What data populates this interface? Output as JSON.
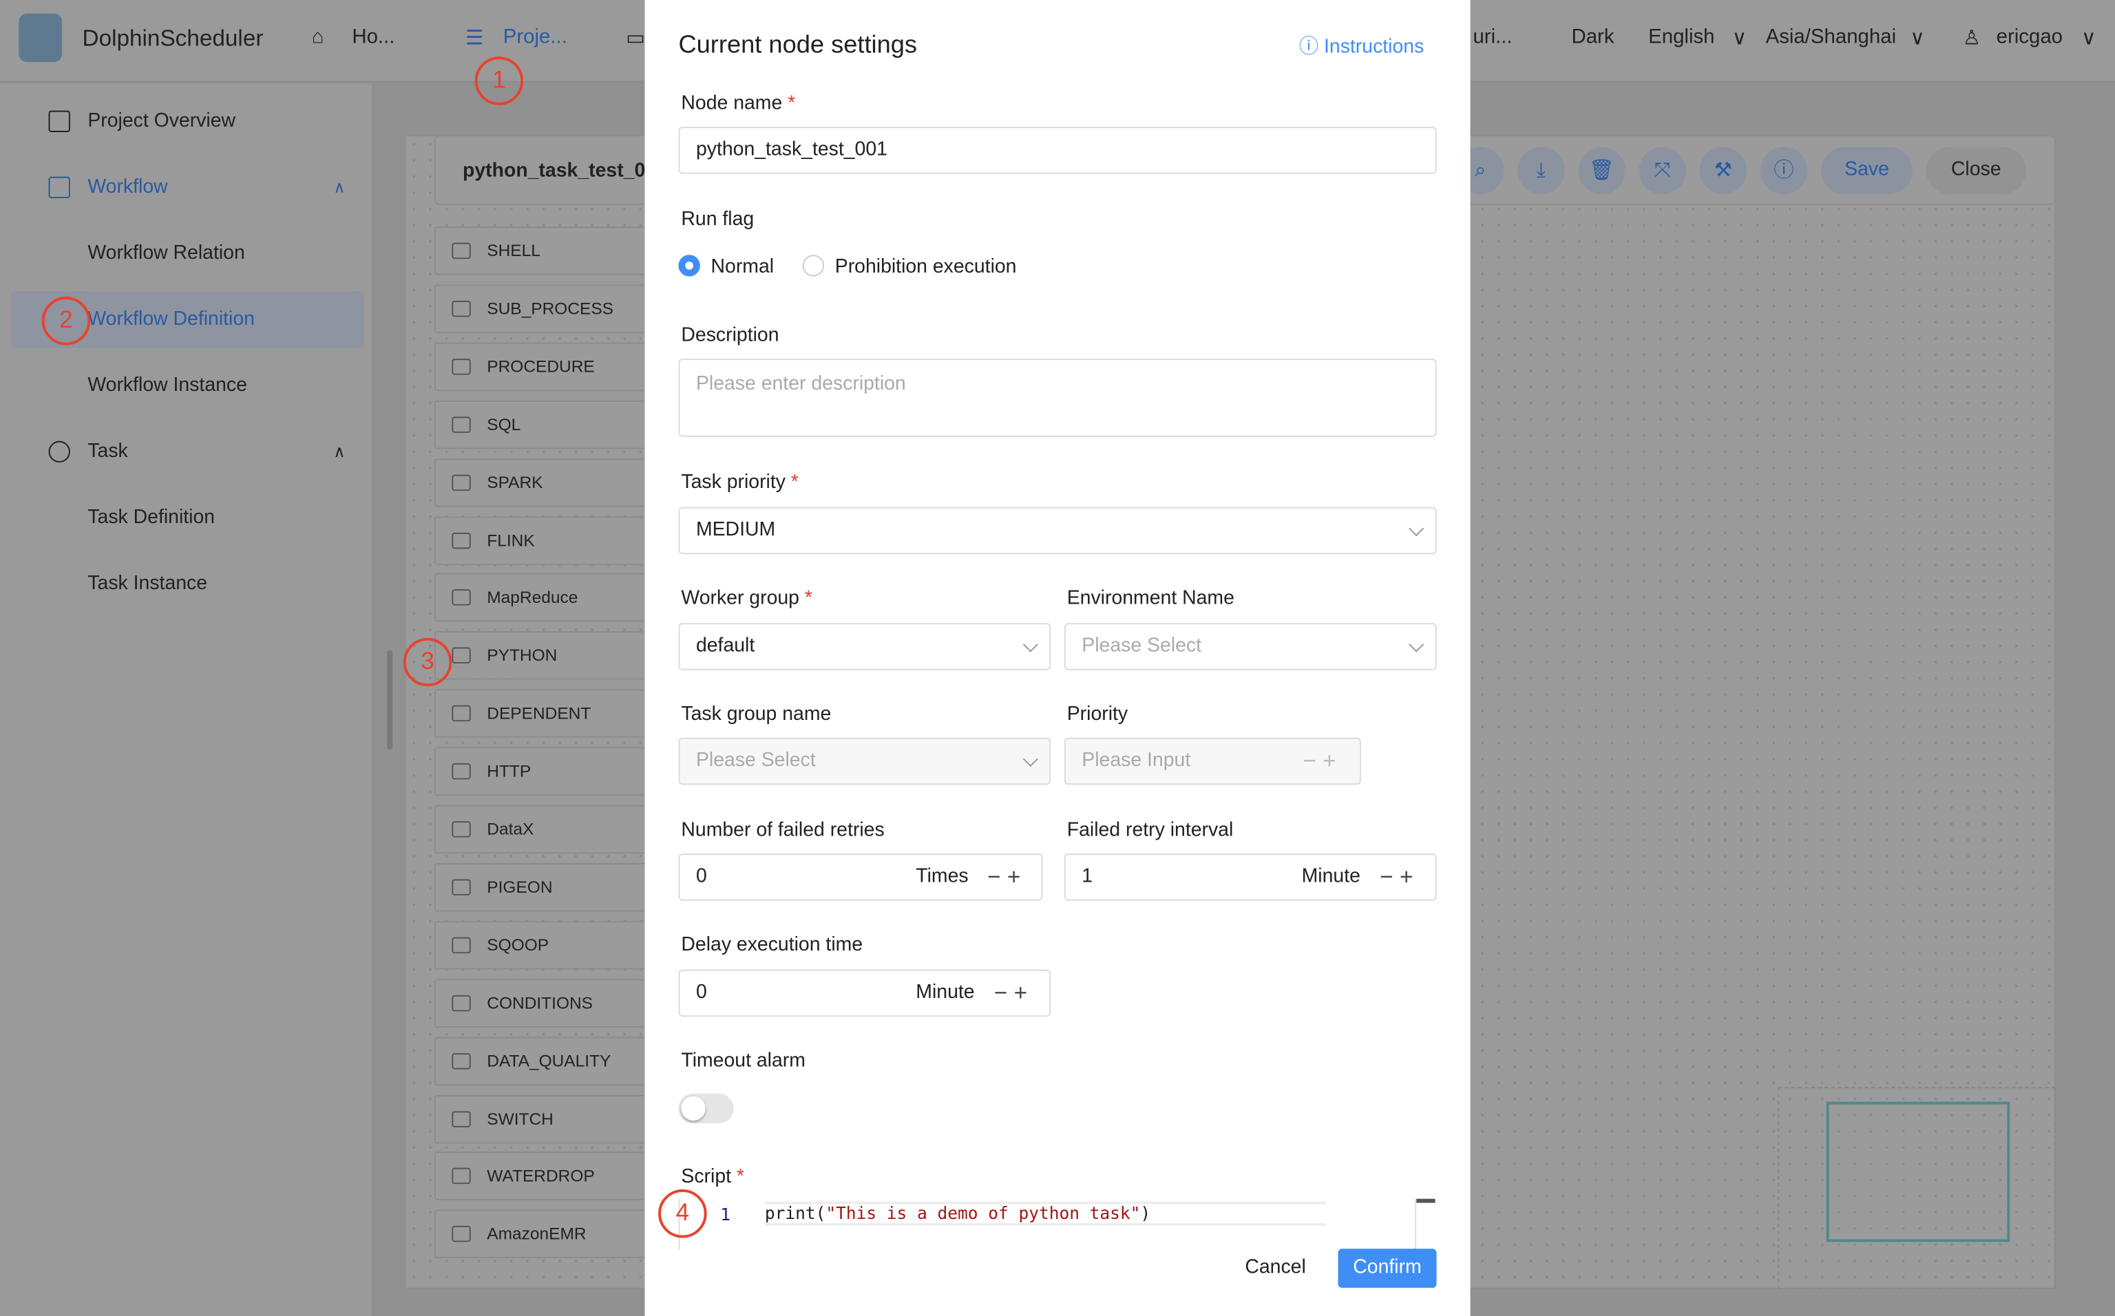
{
  "header": {
    "brand": "DolphinScheduler",
    "nav": [
      "Ho...",
      "Proje...",
      "uri..."
    ],
    "theme": "Dark",
    "language": "English",
    "timezone": "Asia/Shanghai",
    "user": "ericgao"
  },
  "sidebar": {
    "items": [
      {
        "label": "Project Overview",
        "icon": "presentation-chart-icon"
      },
      {
        "label": "Workflow",
        "icon": "workflow-icon",
        "expanded": true
      },
      {
        "label": "Workflow Relation"
      },
      {
        "label": "Workflow Definition",
        "selected": true
      },
      {
        "label": "Workflow Instance"
      },
      {
        "label": "Task",
        "icon": "gear-icon",
        "expanded": true
      },
      {
        "label": "Task Definition"
      },
      {
        "label": "Task Instance"
      }
    ]
  },
  "editor": {
    "workflow_name": "python_task_test_0",
    "save": "Save",
    "close": "Close",
    "toolbar_icons": [
      "search-icon",
      "download-icon",
      "delete-icon",
      "fullscreen-icon",
      "format-icon",
      "info-icon"
    ]
  },
  "palette": [
    "SHELL",
    "SUB_PROCESS",
    "PROCEDURE",
    "SQL",
    "SPARK",
    "FLINK",
    "MapReduce",
    "PYTHON",
    "DEPENDENT",
    "HTTP",
    "DataX",
    "PIGEON",
    "SQOOP",
    "CONDITIONS",
    "DATA_QUALITY",
    "SWITCH",
    "WATERDROP",
    "AmazonEMR"
  ],
  "modal": {
    "title": "Current node settings",
    "instructions": "Instructions",
    "node_name_label": "Node name",
    "node_name": "python_task_test_001",
    "run_flag_label": "Run flag",
    "run_flag_options": [
      "Normal",
      "Prohibition execution"
    ],
    "run_flag_selected": "Normal",
    "description_label": "Description",
    "description_placeholder": "Please enter description",
    "task_priority_label": "Task priority",
    "task_priority": "MEDIUM",
    "worker_group_label": "Worker group",
    "worker_group": "default",
    "environment_label": "Environment Name",
    "environment_placeholder": "Please Select",
    "task_group_label": "Task group name",
    "task_group_placeholder": "Please Select",
    "priority_label": "Priority",
    "priority_placeholder": "Please Input",
    "retries_label": "Number of failed retries",
    "retries": "0",
    "retries_unit": "Times",
    "retry_interval_label": "Failed retry interval",
    "retry_interval": "1",
    "retry_interval_unit": "Minute",
    "delay_label": "Delay execution time",
    "delay": "0",
    "delay_unit": "Minute",
    "timeout_label": "Timeout alarm",
    "timeout_enabled": false,
    "script_label": "Script",
    "script_line": "1",
    "script_fn": "print(",
    "script_str": "\"This is a demo of python task\"",
    "script_end": ")",
    "cancel": "Cancel",
    "confirm": "Confirm"
  },
  "annotations": [
    "1",
    "2",
    "3",
    "4"
  ],
  "colors": {
    "accent": "#3f8ef5",
    "annotation": "#e8432d",
    "required": "#e03c3c"
  }
}
